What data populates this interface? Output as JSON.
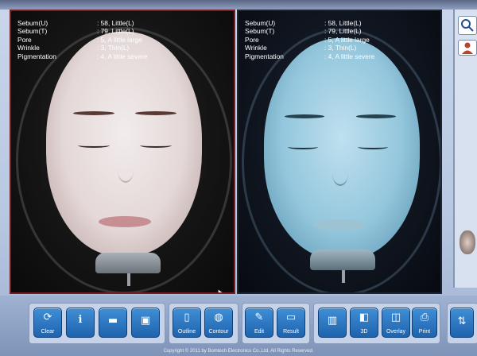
{
  "analysis": [
    {
      "label": "Sebum(U)",
      "value": ": 58, Little(L)"
    },
    {
      "label": "Sebum(T)",
      "value": ": 79, Little(L)"
    },
    {
      "label": "Pore",
      "value": ": 5, A little large"
    },
    {
      "label": "Wrinkle",
      "value": ": 3, Thin(L)"
    },
    {
      "label": "Pigmentation",
      "value": ": 4, A little severe"
    }
  ],
  "toolbar": {
    "clear": "Clear",
    "outline": "Outline",
    "contour": "Contour",
    "edit": "Edit",
    "result": "Result",
    "three_d": "3D",
    "overlay": "Overlay",
    "print": "Print"
  },
  "icons": {
    "search": "search-icon",
    "user": "user-icon",
    "clear": "refresh-icon",
    "info": "info-icon",
    "open": "folder-icon",
    "save": "save-icon"
  },
  "footer": "Copyright © 2011 by Bomtech Electronics Co.,Ltd. All Rights Reserved."
}
